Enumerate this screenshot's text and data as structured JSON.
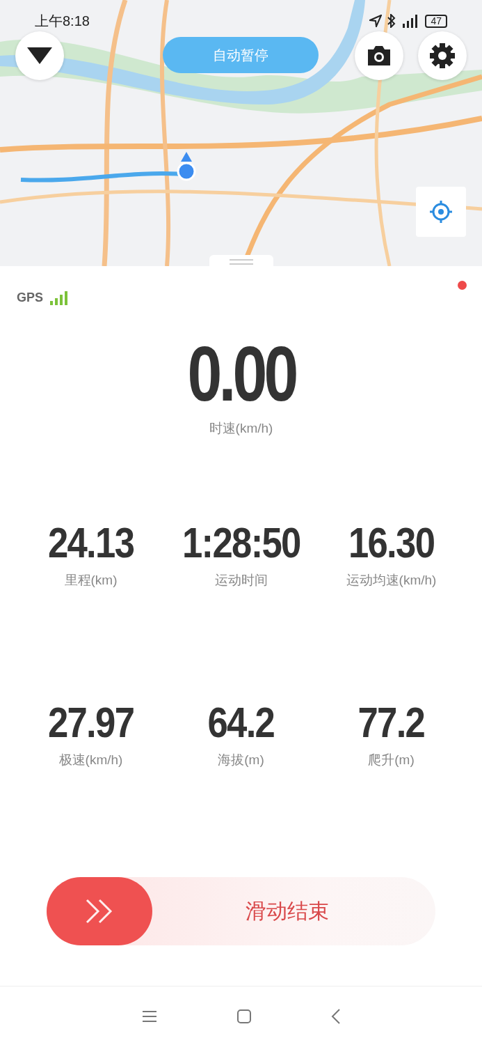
{
  "status_bar": {
    "time": "上午8:18",
    "battery": "47"
  },
  "map": {
    "kind": "picture",
    "pause_button": {
      "label": "自动暂停"
    }
  },
  "gps": {
    "label": "GPS"
  },
  "speed": {
    "value": "0.00",
    "label": "时速(km/h)"
  },
  "stats": [
    {
      "value": "24.13",
      "label": "里程(km)"
    },
    {
      "value": "1:28:50",
      "label": "运动时间"
    },
    {
      "value": "16.30",
      "label": "运动均速(km/h)"
    },
    {
      "value": "27.97",
      "label": "极速(km/h)"
    },
    {
      "value": "64.2",
      "label": "海拔(m)"
    },
    {
      "value": "77.2",
      "label": "爬升(m)"
    }
  ],
  "slider": {
    "label": "滑动结束",
    "level": 0
  }
}
